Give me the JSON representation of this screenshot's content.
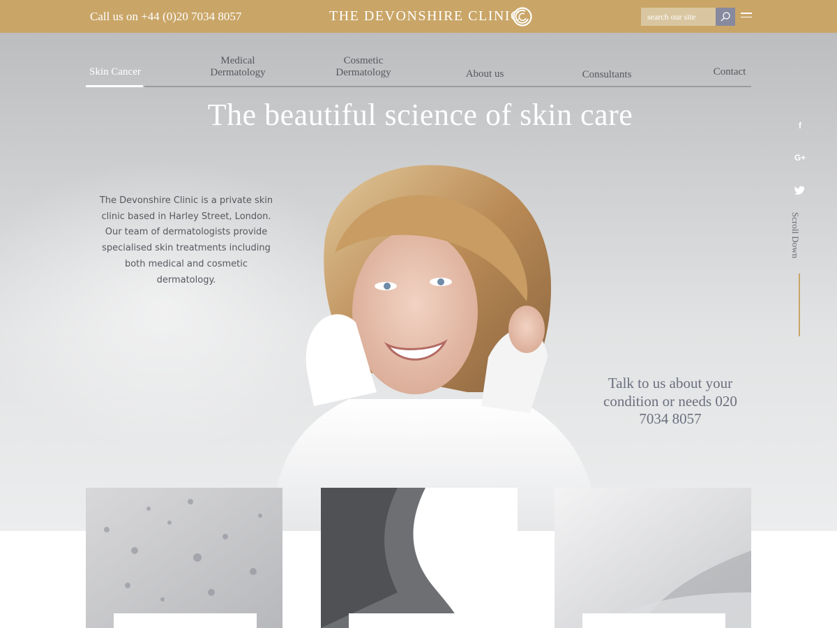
{
  "topbar": {
    "call_text": "Call us on +44 (0)20 7034 8057",
    "brand_name": "THE DEVONSHIRE CLINIC",
    "logo_icon": "clinic-swirl-logo",
    "search_placeholder": "search our site",
    "search_icon": "search-icon",
    "menu_icon": "hamburger-menu-icon",
    "bar_color": "#c9a567"
  },
  "nav": {
    "items": [
      {
        "label": "Skin Cancer",
        "active": true
      },
      {
        "label": "Medical Dermatology"
      },
      {
        "label": "Cosmetic Dermatology"
      },
      {
        "label": "About us"
      },
      {
        "label": "Consultants"
      },
      {
        "label": "Contact"
      }
    ]
  },
  "hero": {
    "headline": "The beautiful science of skin care",
    "intro": "The Devonshire Clinic is a private skin clinic based in Harley Street, London. Our team of dermatologists provide specialised skin treatments including both medical and cosmetic dermatology.",
    "talk_text": "Talk to us about your condition or needs 020 7034 8057"
  },
  "social": {
    "facebook": "f",
    "google_plus": "G+",
    "twitter_icon": "twitter-icon",
    "scroll_label": "Scroll Down"
  },
  "cards": [
    {
      "image": "skin-texture-image"
    },
    {
      "image": "man-portrait-image"
    },
    {
      "image": "fabric-image"
    }
  ]
}
